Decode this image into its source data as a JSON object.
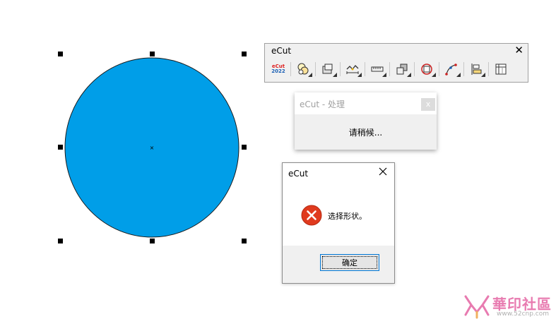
{
  "toolbar": {
    "title": "eCut",
    "close_symbol": "✕",
    "logo_line1": "eCut",
    "logo_line2": "2022",
    "buttons": [
      "ecut-logo-icon",
      "shape-tools-icon",
      "box-tools-icon",
      "dimension-icon",
      "ruler-icon",
      "layers-icon",
      "contour-icon",
      "node-icon",
      "align-icon",
      "table-icon"
    ]
  },
  "processing_dialog": {
    "title": "eCut - 处理",
    "close_symbol": "x",
    "message": "请稍候..."
  },
  "message_box": {
    "title": "eCut",
    "icon": "error-icon",
    "text": "选择形状。",
    "ok_label": "确定"
  },
  "canvas": {
    "shape": "circle",
    "fill_color": "#009ee8",
    "center_marker": "×"
  },
  "watermark": {
    "title": "華印社區",
    "url": "www.52cnp.com"
  },
  "colors": {
    "circle_fill": "#009ee8",
    "error_red": "#e03a1e",
    "button_border": "#0078d7"
  }
}
